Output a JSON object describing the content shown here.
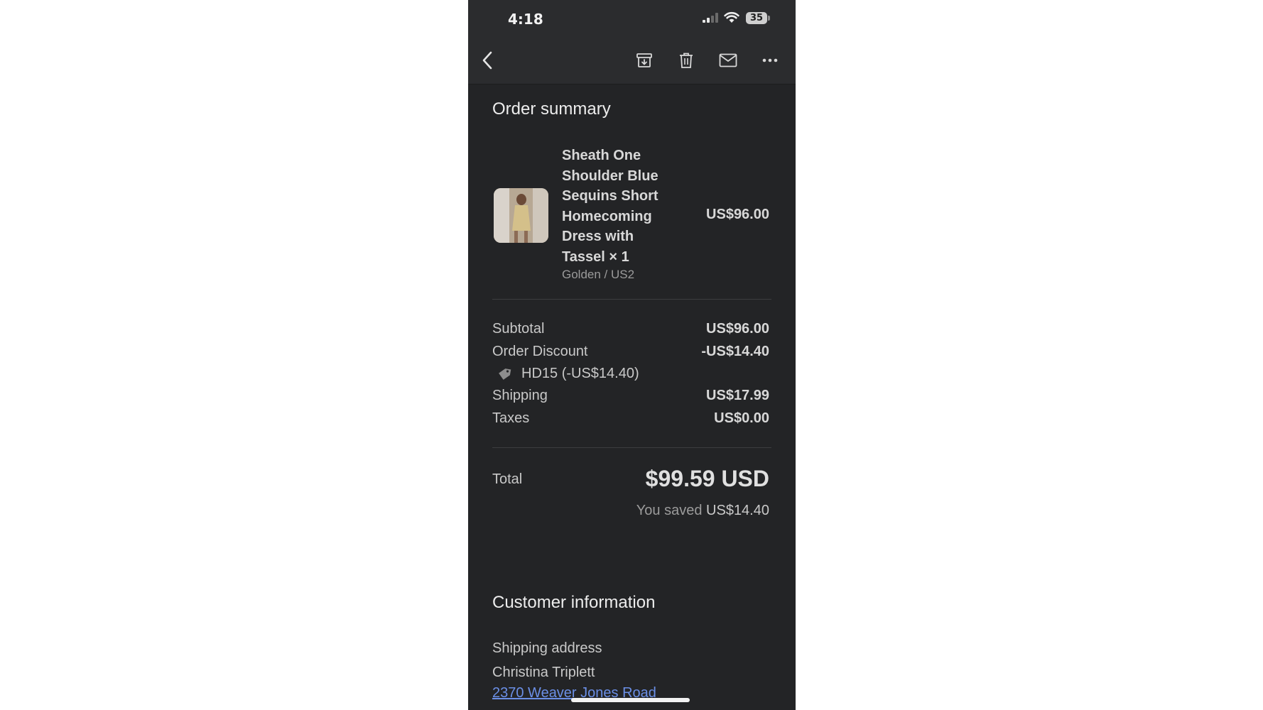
{
  "status_bar": {
    "time": "4:18",
    "battery": "35"
  },
  "toolbar": {
    "icons": [
      "chevron-left-icon",
      "archive-icon",
      "trash-icon",
      "mail-icon",
      "more-icon"
    ]
  },
  "order_summary": {
    "title": "Order summary",
    "item": {
      "name": "Sheath One Shoulder Blue Sequins Short Homecoming Dress with Tassel × 1",
      "variant": "Golden / US2",
      "price": "US$96.00"
    },
    "subtotal_label": "Subtotal",
    "subtotal_value": "US$96.00",
    "discount_label": "Order Discount",
    "discount_value": "-US$14.40",
    "discount_code": "HD15 (-US$14.40)",
    "shipping_label": "Shipping",
    "shipping_value": "US$17.99",
    "taxes_label": "Taxes",
    "taxes_value": "US$0.00",
    "total_label": "Total",
    "total_value": "$99.59 USD",
    "saved_label": "You saved",
    "saved_value": "US$14.40"
  },
  "customer_info": {
    "title": "Customer information",
    "shipping_address_label": "Shipping address",
    "name": "Christina Triplett",
    "address_line": "2370 Weaver Jones Road"
  },
  "colors": {
    "background": "#232426",
    "toolbar": "#2b2c2e",
    "link": "#6b8fe6"
  }
}
